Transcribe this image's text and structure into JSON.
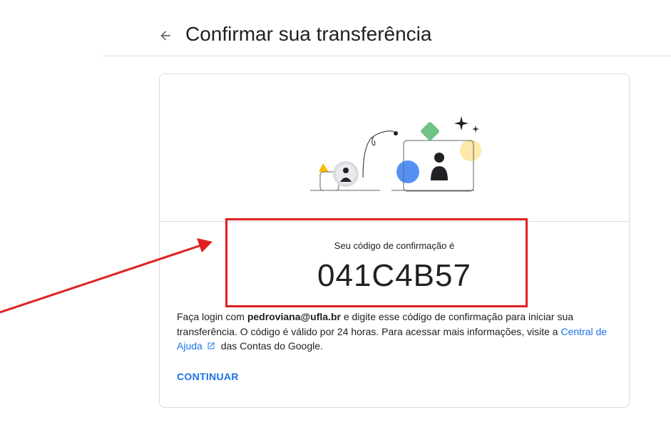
{
  "header": {
    "title": "Confirmar sua transferência",
    "back_icon": "arrow-left-icon"
  },
  "card": {
    "code_label": "Seu código de confirmação é",
    "code": "041C4B57",
    "instructions": {
      "part1": "Faça login com ",
      "email": "pedroviana@ufla.br",
      "part2": " e digite esse código de confirmação para iniciar sua transferência. O código é válido por 24 horas. Para acessar mais informações, visite a ",
      "link_text": "Central de Ajuda",
      "part3": " das Contas do Google."
    },
    "continue_label": "CONTINUAR"
  },
  "colors": {
    "accent": "#1a73e8",
    "highlight": "#e02020",
    "divider": "#dadce0"
  }
}
